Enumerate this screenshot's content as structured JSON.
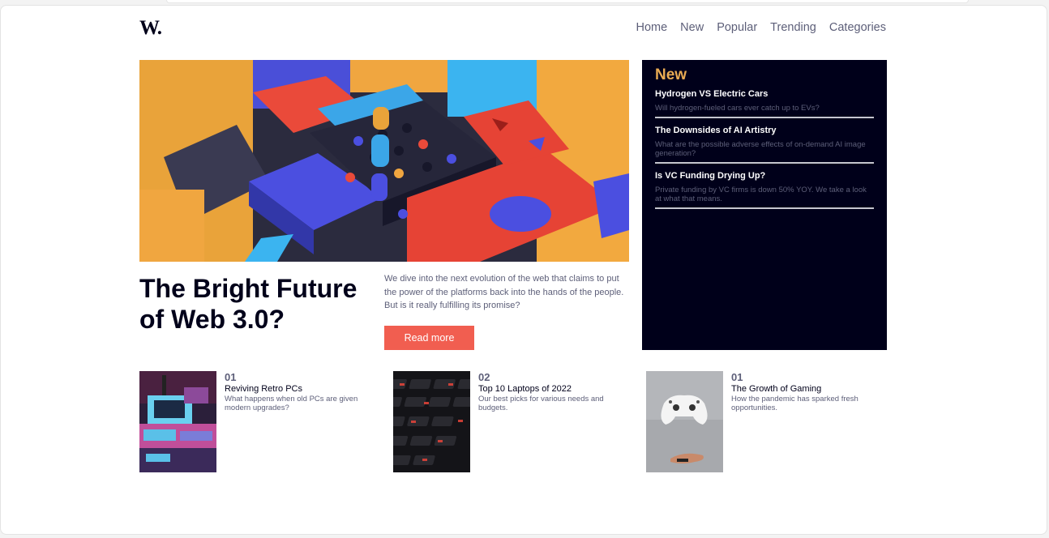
{
  "header": {
    "logo": "W.",
    "nav": [
      "Home",
      "New",
      "Popular",
      "Trending",
      "Categories"
    ]
  },
  "hero": {
    "image_icon": "abstract-3d-blocks-image",
    "title": "The Bright Future of Web 3.0?",
    "description": "We dive into the next evolution of the web that claims to put the power of the platforms back into the hands of the people. But is it really fulfilling its promise?",
    "button_label": "Read more"
  },
  "new_panel": {
    "heading": "New",
    "items": [
      {
        "title": "Hydrogen VS Electric Cars",
        "description": "Will hydrogen-fueled cars ever catch up to EVs?"
      },
      {
        "title": "The Downsides of AI Artistry",
        "description": "What are the possible adverse effects of on-demand AI image generation?"
      },
      {
        "title": "Is VC Funding Drying Up?",
        "description": "Private funding by VC firms is down 50% YOY. We take a look at what that means."
      }
    ]
  },
  "cards": [
    {
      "number": "01",
      "title": "Reviving Retro PCs",
      "description": "What happens when old PCs are given modern upgrades?",
      "image": "retro-pc-image"
    },
    {
      "number": "02",
      "title": "Top 10 Laptops of 2022",
      "description": "Our best picks for various needs and budgets.",
      "image": "laptop-keyboard-image"
    },
    {
      "number": "01",
      "title": "The Growth of Gaming",
      "description": "How the pandemic has sparked fresh opportunities.",
      "image": "game-controller-image"
    }
  ],
  "colors": {
    "accent_orange": "#e9ab53",
    "button_red": "#f15e50",
    "dark_navy": "#00001a",
    "muted_text": "#5d5f79"
  }
}
